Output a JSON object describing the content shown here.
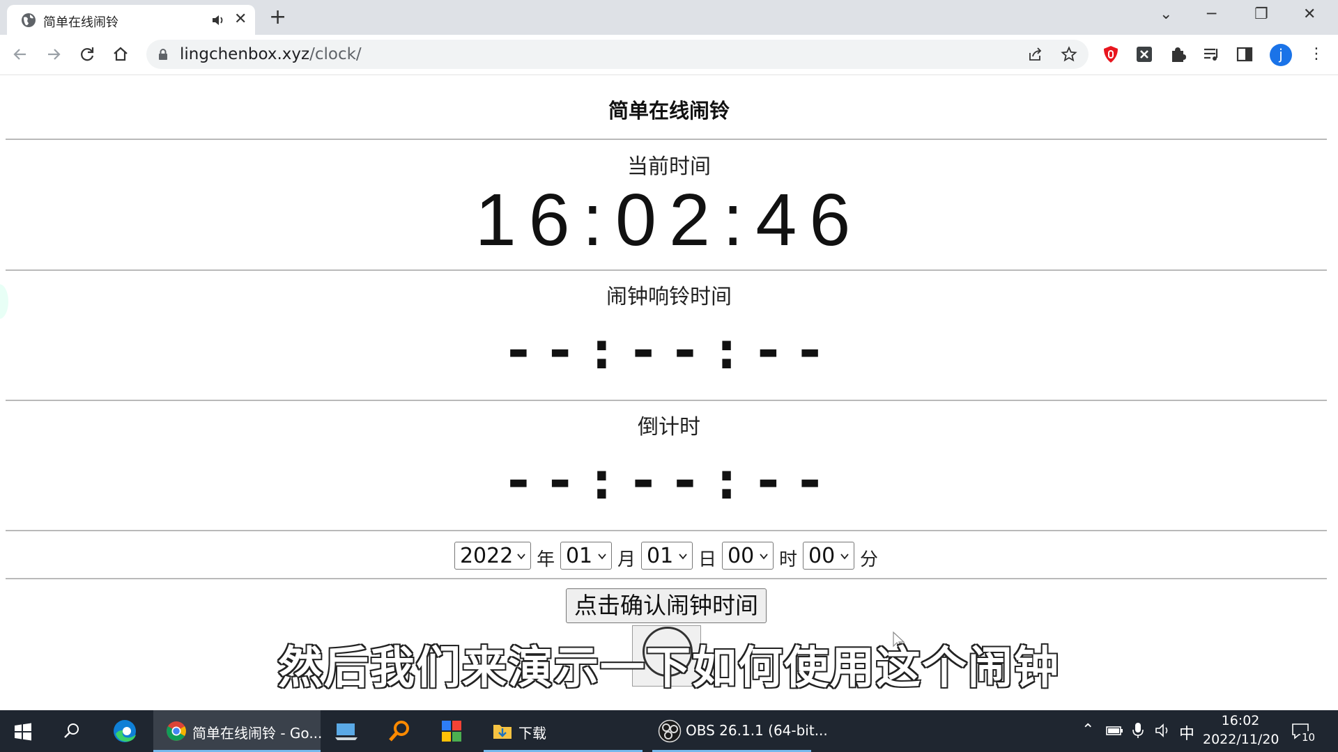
{
  "browser": {
    "tab_title": "简单在线闹铃",
    "new_tab": "+",
    "tab_close": "✕",
    "url_domain": "lingchenbox.xyz",
    "url_path": "/clock/",
    "avatar_letter": "j",
    "window_controls": {
      "minimize": "─",
      "restore": "❐",
      "close": "✕",
      "tab_search": "⌄"
    },
    "menu": "⋮"
  },
  "page": {
    "title": "简单在线闹铃",
    "current_time_label": "当前时间",
    "current_time": "16:02:46",
    "alarm_label": "闹钟响铃时间",
    "alarm_time": "--:--:--",
    "countdown_label": "倒计时",
    "countdown_time": "--:--:--",
    "date_selects": {
      "year": "2022",
      "year_unit": "年",
      "month": "01",
      "month_unit": "月",
      "day": "01",
      "day_unit": "日",
      "hour": "00",
      "hour_unit": "时",
      "minute": "00",
      "minute_unit": "分"
    },
    "confirm_button": "点击确认闹钟时间"
  },
  "subtitle": "然后我们来演示一下如何使用这个闹钟",
  "taskbar": {
    "chrome_label": "简单在线闹铃 - Go...",
    "explorer_label": "下载",
    "obs_label": "OBS 26.1.1 (64-bit...",
    "ime": "中",
    "clock_time": "16:02",
    "clock_date": "2022/11/20",
    "notification_count": "10"
  }
}
